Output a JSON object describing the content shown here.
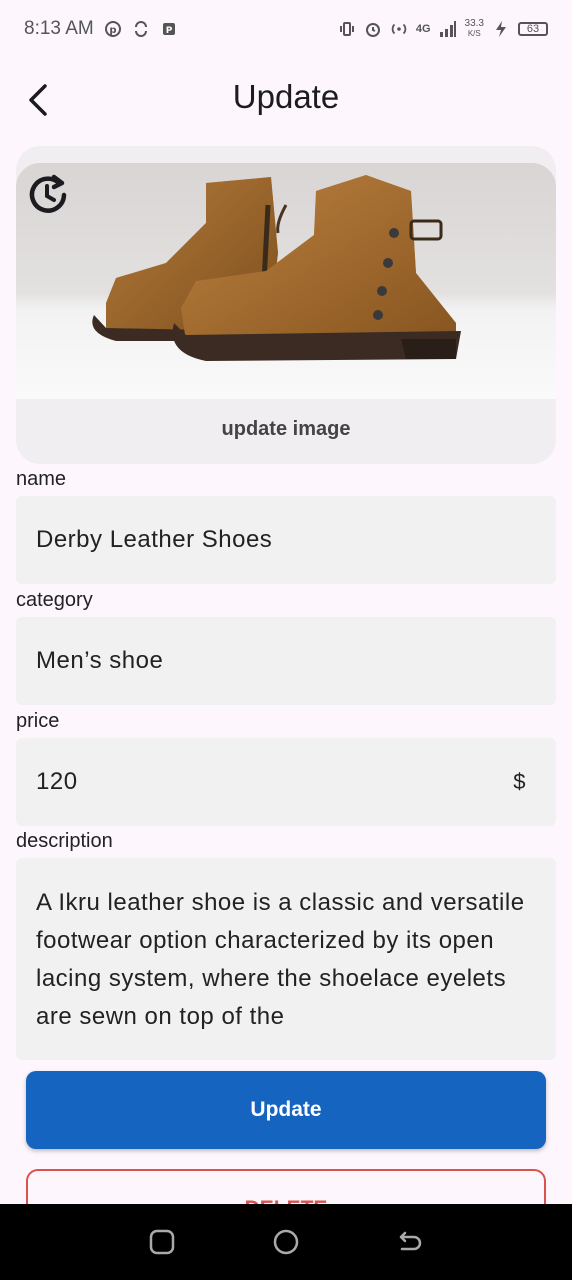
{
  "status_bar": {
    "time": "8:13 AM",
    "net_speed": "33.3",
    "net_unit": "K/S",
    "network": "4G",
    "battery": "63"
  },
  "header": {
    "title": "Update"
  },
  "image_card": {
    "update_label": "update image"
  },
  "form": {
    "name_label": "name",
    "name_value": "Derby Leather Shoes",
    "category_label": "category",
    "category_value": "Men’s shoe",
    "price_label": "price",
    "price_value": "120",
    "price_suffix": "$",
    "description_label": "description",
    "description_value": "A Ikru leather shoe is a classic and versatile footwear option characterized by its open lacing system, where the shoelace eyelets are sewn on top of the"
  },
  "actions": {
    "update_label": "Update",
    "delete_label": "DELETE"
  },
  "colors": {
    "primary": "#1565c0",
    "danger": "#d9534f",
    "background": "#fdf7fd"
  }
}
